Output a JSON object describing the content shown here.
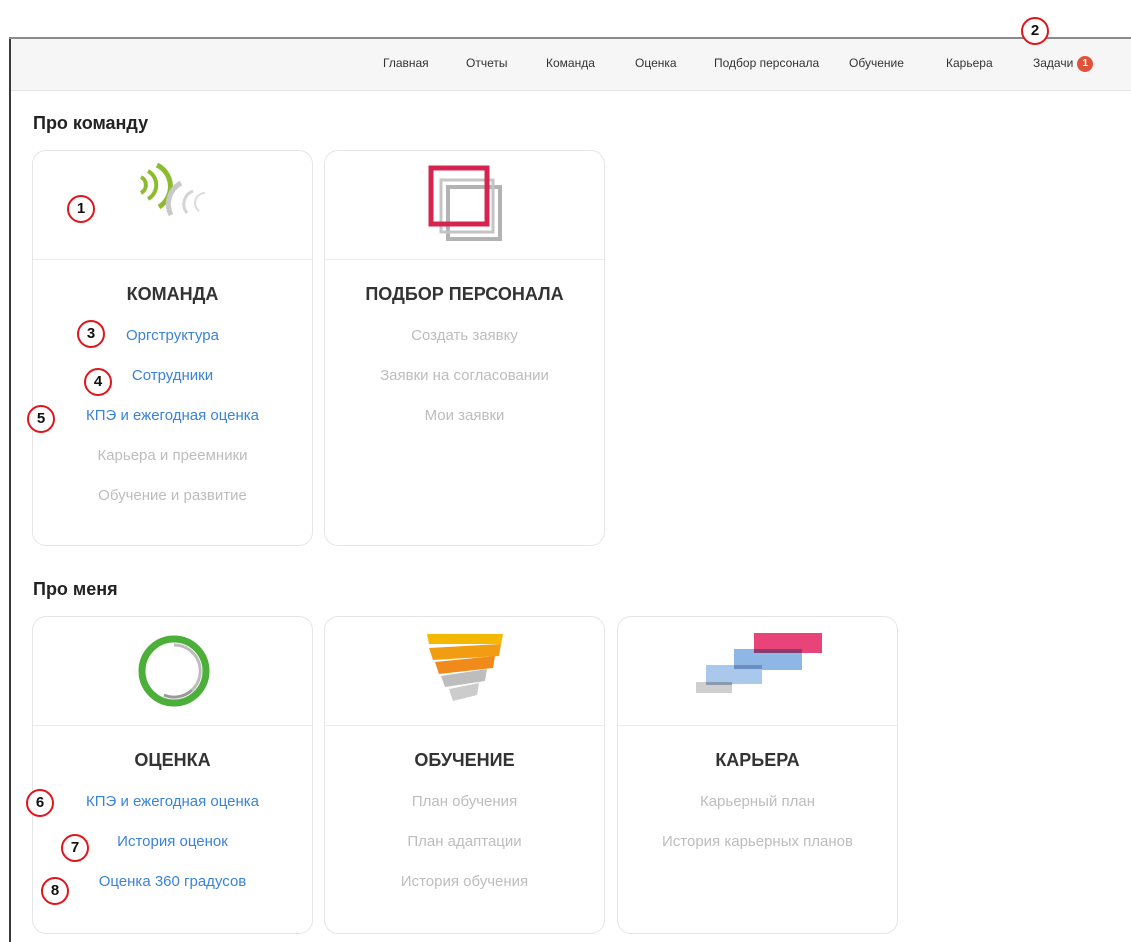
{
  "nav": {
    "items": [
      "Главная",
      "Отчеты",
      "Команда",
      "Оценка",
      "Подбор персонала",
      "Обучение",
      "Карьера"
    ],
    "tasks_label": "Задачи",
    "tasks_badge": "1"
  },
  "sections": {
    "team_title": "Про команду",
    "me_title": "Про меня"
  },
  "cards": {
    "team": {
      "title": "КОМАНДА",
      "links": [
        "Оргструктура",
        "Сотрудники",
        "КПЭ и ежегодная оценка",
        "Карьера и преемники",
        "Обучение и развитие"
      ]
    },
    "recruiting": {
      "title": "ПОДБОР ПЕРСОНАЛА",
      "links": [
        "Создать заявку",
        "Заявки на согласовании",
        "Мои заявки"
      ]
    },
    "assessment": {
      "title": "ОЦЕНКА",
      "links": [
        "КПЭ и ежегодная оценка",
        "История оценок",
        "Оценка 360 градусов"
      ]
    },
    "learning": {
      "title": "ОБУЧЕНИЕ",
      "links": [
        "План обучения",
        "План адаптации",
        "История обучения"
      ]
    },
    "career": {
      "title": "КАРЬЕРА",
      "links": [
        "Карьерный план",
        "История карьерных планов"
      ]
    }
  },
  "markers": [
    "1",
    "2",
    "3",
    "4",
    "5",
    "6",
    "7",
    "8"
  ],
  "colors": {
    "link_active": "#3a83d6",
    "link_disabled": "#bdbdbd",
    "marker_ring": "#e0161d",
    "badge": "#e0523a"
  },
  "icons": [
    "team-signal-icon",
    "recruiting-squares-icon",
    "assessment-ring-icon",
    "learning-funnel-icon",
    "career-steps-icon"
  ]
}
